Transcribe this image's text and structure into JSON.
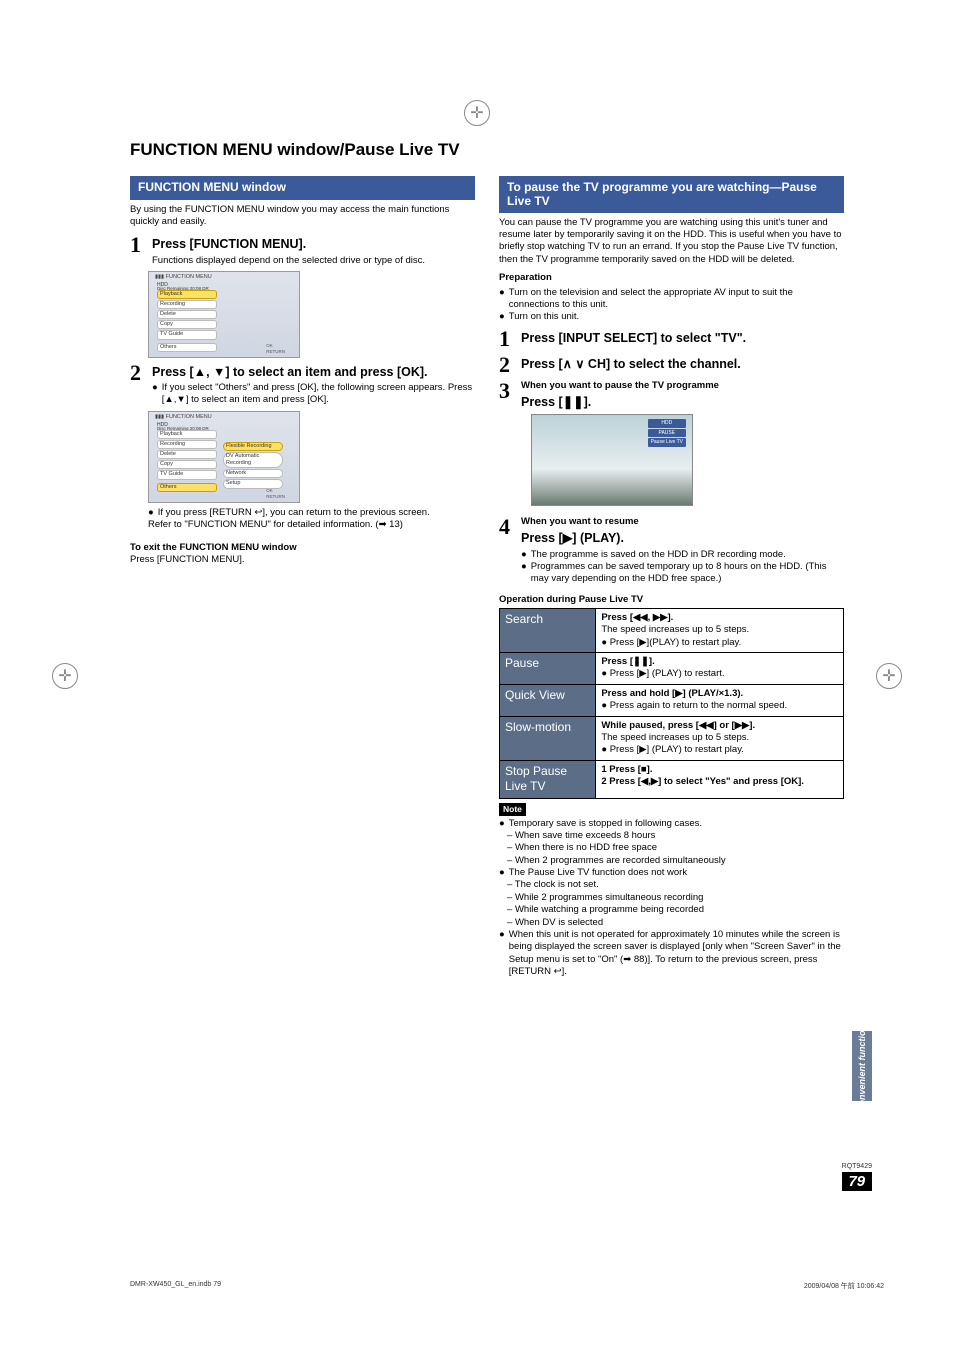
{
  "page_title": "FUNCTION MENU window/Pause Live TV",
  "left": {
    "heading": "FUNCTION MENU window",
    "intro": "By using the FUNCTION MENU window you may access the main functions quickly and easily.",
    "step1": {
      "title": "Press [FUNCTION MENU].",
      "desc": "Functions displayed depend on the selected drive or type of disc."
    },
    "shot1": {
      "items": [
        "Playback",
        "Recording",
        "Delete",
        "Copy",
        "TV Guide",
        "Others"
      ],
      "hdd": "HDD",
      "remain": "Disc Remaining   20:08 DR"
    },
    "step2": {
      "title": "Press [▲, ▼] to select an item and press [OK].",
      "b1": "If you select \"Others\" and press [OK], the following screen appears. Press [▲,▼] to select an item and press [OK]."
    },
    "shot2": {
      "left_items": [
        "Playback",
        "Recording",
        "Delete",
        "Copy",
        "TV Guide",
        "Others"
      ],
      "right_items": [
        "Flexible Recording",
        "DV Automatic Recording",
        "Network",
        "Setup"
      ],
      "remain": "Disc Remaining   20:08 DR"
    },
    "after2_b1": "If you press [RETURN ↩], you can return to the previous screen.",
    "after2_ref": "Refer to \"FUNCTION MENU\" for detailed information. (➡ 13)",
    "exit_head": "To exit the FUNCTION MENU window",
    "exit_body": "Press [FUNCTION MENU]."
  },
  "right": {
    "heading": "To pause the TV programme you are watching—Pause Live TV",
    "intro": "You can pause the TV programme you are watching using this unit's tuner and resume later by temporarily saving it on the HDD. This is useful when you have to briefly stop watching TV to run an errand. If you stop the Pause Live TV function, then the TV programme temporarily saved on the HDD will be deleted.",
    "prep_head": "Preparation",
    "prep_b1": "Turn on the television and select the appropriate AV input to suit the connections to this unit.",
    "prep_b2": "Turn on this unit.",
    "step1": "Press [INPUT SELECT] to select \"TV\".",
    "step2": "Press [∧ ∨ CH] to select the channel.",
    "step3_small": "When you want to pause the TV programme",
    "step3_title": "Press [❚❚].",
    "tv_badges": [
      "HDD",
      "PAUSE",
      "Pause Live TV"
    ],
    "step4_small": "When you want to resume",
    "step4_title": "Press [▶] (PLAY).",
    "step4_b1": "The programme is saved on the HDD in DR recording mode.",
    "step4_b2": "Programmes can be saved temporary up to 8 hours on the HDD. (This may vary depending on the HDD free space.)",
    "ops_head": "Operation during Pause Live TV",
    "table": [
      {
        "label": "Search",
        "title": "Press [◀◀, ▶▶].",
        "lines": [
          "The speed increases up to 5 steps.",
          "● Press [▶](PLAY) to restart play."
        ]
      },
      {
        "label": "Pause",
        "title": "Press [❚❚].",
        "lines": [
          "● Press [▶] (PLAY) to restart."
        ]
      },
      {
        "label": "Quick View",
        "title": "Press and hold [▶] (PLAY/×1.3).",
        "lines": [
          "● Press again to return to the normal speed."
        ]
      },
      {
        "label": "Slow-motion",
        "title": "While paused, press [◀◀] or [▶▶].",
        "lines": [
          "The speed increases up to 5 steps.",
          "● Press [▶] (PLAY) to restart play."
        ]
      },
      {
        "label": "Stop Pause Live TV",
        "title": "",
        "lines": [
          "1  Press [■].",
          "2  Press [◀,▶] to select \"Yes\" and press [OK]."
        ]
      }
    ],
    "note": "Note",
    "note_b1": "Temporary save is stopped in following cases.",
    "note_d1": "When save time exceeds 8 hours",
    "note_d2": "When there is no HDD free space",
    "note_d3": "When 2 programmes are recorded simultaneously",
    "note_b2": "The Pause Live TV function does not work",
    "note_d4": "The clock is not set.",
    "note_d5": "While 2 programmes simultaneous recording",
    "note_d6": "While watching a programme being recorded",
    "note_d7": "When DV is selected",
    "note_b3": "When this unit is not operated for approximately 10 minutes while the screen is being displayed the screen saver is displayed [only when \"Screen Saver\" in the Setup menu is set to \"On\" (➡ 88)]. To return to the previous screen, press [RETURN ↩]."
  },
  "side_tab": "Convenient functions",
  "rqt": "RQT9429",
  "page_num": "79",
  "footer_left": "DMR-XW450_GL_en.indb   79",
  "footer_right": "2009/04/08   午前 10:06:42"
}
